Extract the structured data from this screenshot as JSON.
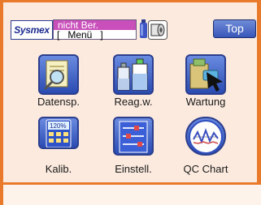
{
  "header": {
    "logo_text": "Sysmex",
    "status_line1": "nicht Ber.",
    "status_line2": "[   Menü   ]",
    "top_button": "Top"
  },
  "menu": {
    "datensp": "Datensp.",
    "reagw": "Reag.w.",
    "wartung": "Wartung",
    "kalib": "Kalib.",
    "einstell": "Einstell.",
    "qc_chart": "QC Chart"
  },
  "icon_texts": {
    "kalib_percent": "120%"
  },
  "colors": {
    "frame_orange": "#e97a2c",
    "screen_bg": "#fbeadd",
    "status_magenta": "#c94fbb",
    "button_blue": "#3856b8"
  }
}
